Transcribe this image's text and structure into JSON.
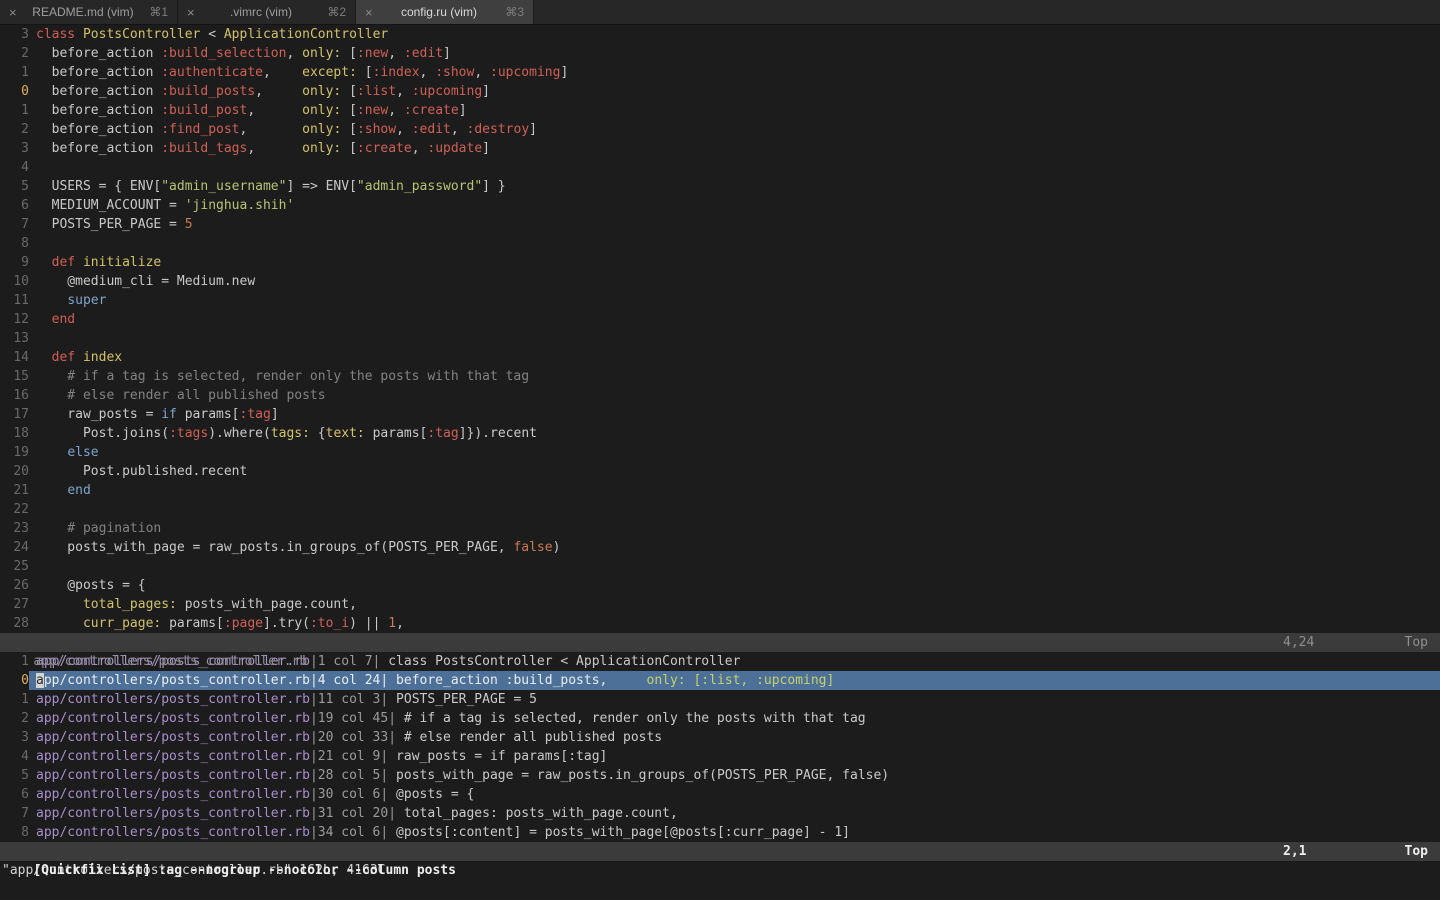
{
  "colors": {
    "bg": "#1c1c1c",
    "fg": "#c9c9c9",
    "red": "#cf6055",
    "yellow": "#d2c269",
    "green": "#b8c474",
    "blue": "#7ea5cc",
    "orange": "#cb7950",
    "comment": "#828282",
    "gutter": "#696969",
    "gutter_current": "#dfae5c",
    "qf_file": "#a78fcb",
    "qf_num": "#9b9b9b",
    "qf_sel_bg": "#4d7098",
    "qf_sel_fg": "#e9edf2",
    "qf_sel_match": "#c6d06b",
    "cursor_bg": "#d4d4d4",
    "cursor_fg": "#2a2a2a",
    "status_bg": "#3b3b3b",
    "tabbar_bg": "#272727",
    "tab_active_bg": "#3f3f3f"
  },
  "tabbar": {
    "close_glyph": "×",
    "tabs": [
      {
        "label": "README.md (vim)",
        "shortcut": "⌘1",
        "active": false
      },
      {
        "label": ".vimrc (vim)",
        "shortcut": "⌘2",
        "active": false
      },
      {
        "label": "config.ru (vim)",
        "shortcut": "⌘3",
        "active": true
      }
    ]
  },
  "editor": {
    "lines": [
      {
        "num": "3",
        "segs": [
          [
            "class ",
            "k"
          ],
          [
            "PostsController",
            "y"
          ],
          [
            " < ",
            "fg"
          ],
          [
            "ApplicationController",
            "y"
          ]
        ]
      },
      {
        "num": "2",
        "segs": [
          [
            "  before_action ",
            "fg"
          ],
          [
            ":build_selection",
            "k"
          ],
          [
            ", ",
            "fg"
          ],
          [
            "only:",
            "y"
          ],
          [
            " [",
            "fg"
          ],
          [
            ":new",
            "k"
          ],
          [
            ", ",
            "fg"
          ],
          [
            ":edit",
            "k"
          ],
          [
            "]",
            "fg"
          ]
        ]
      },
      {
        "num": "1",
        "segs": [
          [
            "  before_action ",
            "fg"
          ],
          [
            ":authenticate",
            "k"
          ],
          [
            ",    ",
            "fg"
          ],
          [
            "except:",
            "y"
          ],
          [
            " [",
            "fg"
          ],
          [
            ":index",
            "k"
          ],
          [
            ", ",
            "fg"
          ],
          [
            ":show",
            "k"
          ],
          [
            ", ",
            "fg"
          ],
          [
            ":upcoming",
            "k"
          ],
          [
            "]",
            "fg"
          ]
        ]
      },
      {
        "num": "0",
        "current": true,
        "segs": [
          [
            "  before_action ",
            "fg"
          ],
          [
            ":build_posts",
            "k"
          ],
          [
            ",     ",
            "fg"
          ],
          [
            "only:",
            "y"
          ],
          [
            " [",
            "fg"
          ],
          [
            ":list",
            "k"
          ],
          [
            ", ",
            "fg"
          ],
          [
            ":upcoming",
            "k"
          ],
          [
            "]",
            "fg"
          ]
        ]
      },
      {
        "num": "1",
        "segs": [
          [
            "  before_action ",
            "fg"
          ],
          [
            ":build_post",
            "k"
          ],
          [
            ",      ",
            "fg"
          ],
          [
            "only:",
            "y"
          ],
          [
            " [",
            "fg"
          ],
          [
            ":new",
            "k"
          ],
          [
            ", ",
            "fg"
          ],
          [
            ":create",
            "k"
          ],
          [
            "]",
            "fg"
          ]
        ]
      },
      {
        "num": "2",
        "segs": [
          [
            "  before_action ",
            "fg"
          ],
          [
            ":find_post",
            "k"
          ],
          [
            ",       ",
            "fg"
          ],
          [
            "only:",
            "y"
          ],
          [
            " [",
            "fg"
          ],
          [
            ":show",
            "k"
          ],
          [
            ", ",
            "fg"
          ],
          [
            ":edit",
            "k"
          ],
          [
            ", ",
            "fg"
          ],
          [
            ":destroy",
            "k"
          ],
          [
            "]",
            "fg"
          ]
        ]
      },
      {
        "num": "3",
        "segs": [
          [
            "  before_action ",
            "fg"
          ],
          [
            ":build_tags",
            "k"
          ],
          [
            ",      ",
            "fg"
          ],
          [
            "only:",
            "y"
          ],
          [
            " [",
            "fg"
          ],
          [
            ":create",
            "k"
          ],
          [
            ", ",
            "fg"
          ],
          [
            ":update",
            "k"
          ],
          [
            "]",
            "fg"
          ]
        ]
      },
      {
        "num": "4",
        "segs": []
      },
      {
        "num": "5",
        "segs": [
          [
            "  USERS = { ENV[",
            "fg"
          ],
          [
            "\"admin_username\"",
            "g"
          ],
          [
            "] => ENV[",
            "fg"
          ],
          [
            "\"admin_password\"",
            "g"
          ],
          [
            "] }",
            "fg"
          ]
        ]
      },
      {
        "num": "6",
        "segs": [
          [
            "  MEDIUM_ACCOUNT = ",
            "fg"
          ],
          [
            "'jinghua.shih'",
            "g"
          ]
        ]
      },
      {
        "num": "7",
        "segs": [
          [
            "  POSTS_PER_PAGE = ",
            "fg"
          ],
          [
            "5",
            "n"
          ]
        ]
      },
      {
        "num": "8",
        "segs": []
      },
      {
        "num": "9",
        "segs": [
          [
            "  ",
            "fg"
          ],
          [
            "def ",
            "k"
          ],
          [
            "initialize",
            "y"
          ]
        ]
      },
      {
        "num": "10",
        "segs": [
          [
            "    @medium_cli = Medium.new",
            "fg"
          ]
        ]
      },
      {
        "num": "11",
        "segs": [
          [
            "    ",
            "fg"
          ],
          [
            "super",
            "b"
          ]
        ]
      },
      {
        "num": "12",
        "segs": [
          [
            "  ",
            "fg"
          ],
          [
            "end",
            "k"
          ]
        ]
      },
      {
        "num": "13",
        "segs": []
      },
      {
        "num": "14",
        "segs": [
          [
            "  ",
            "fg"
          ],
          [
            "def ",
            "k"
          ],
          [
            "index",
            "y"
          ]
        ]
      },
      {
        "num": "15",
        "segs": [
          [
            "    # if a tag is selected, render only the posts with that tag",
            "c"
          ]
        ]
      },
      {
        "num": "16",
        "segs": [
          [
            "    # else render all published posts",
            "c"
          ]
        ]
      },
      {
        "num": "17",
        "segs": [
          [
            "    raw_posts = ",
            "fg"
          ],
          [
            "if",
            "b"
          ],
          [
            " params[",
            "fg"
          ],
          [
            ":tag",
            "k"
          ],
          [
            "]",
            "fg"
          ]
        ]
      },
      {
        "num": "18",
        "segs": [
          [
            "      Post.joins(",
            "fg"
          ],
          [
            ":tags",
            "k"
          ],
          [
            ").where(",
            "fg"
          ],
          [
            "tags:",
            "y"
          ],
          [
            " {",
            "fg"
          ],
          [
            "text:",
            "y"
          ],
          [
            " params[",
            "fg"
          ],
          [
            ":tag",
            "k"
          ],
          [
            "]}).recent",
            "fg"
          ]
        ]
      },
      {
        "num": "19",
        "segs": [
          [
            "    ",
            "fg"
          ],
          [
            "else",
            "b"
          ]
        ]
      },
      {
        "num": "20",
        "segs": [
          [
            "      Post.published.recent",
            "fg"
          ]
        ]
      },
      {
        "num": "21",
        "segs": [
          [
            "    ",
            "fg"
          ],
          [
            "end",
            "b"
          ]
        ]
      },
      {
        "num": "22",
        "segs": []
      },
      {
        "num": "23",
        "segs": [
          [
            "    # pagination",
            "c"
          ]
        ]
      },
      {
        "num": "24",
        "segs": [
          [
            "    posts_with_page = raw_posts.in_groups_of(POSTS_PER_PAGE, ",
            "fg"
          ],
          [
            "false",
            "n"
          ],
          [
            ")",
            "fg"
          ]
        ]
      },
      {
        "num": "25",
        "segs": []
      },
      {
        "num": "26",
        "segs": [
          [
            "    @posts = {",
            "fg"
          ]
        ]
      },
      {
        "num": "27",
        "segs": [
          [
            "      ",
            "fg"
          ],
          [
            "total_pages:",
            "y"
          ],
          [
            " posts_with_page.count,",
            "fg"
          ]
        ]
      },
      {
        "num": "28",
        "segs": [
          [
            "      ",
            "fg"
          ],
          [
            "curr_page:",
            "y"
          ],
          [
            " params[",
            "fg"
          ],
          [
            ":page",
            "k"
          ],
          [
            "].try(",
            "fg"
          ],
          [
            ":to_i",
            "k"
          ],
          [
            ") || ",
            "fg"
          ],
          [
            "1",
            "n"
          ],
          [
            ",",
            "fg"
          ]
        ]
      }
    ]
  },
  "status_editor": {
    "left": "app/controllers/posts_controller.rb",
    "position": "4,24",
    "scroll": "Top"
  },
  "quickfix": {
    "lines": [
      {
        "num": "1",
        "segs": [
          [
            "app/controllers/posts_controller.rb",
            "qf"
          ],
          [
            "|1 col 7|",
            "qn"
          ],
          [
            " class PostsController < ApplicationController",
            "fg"
          ]
        ]
      },
      {
        "num": "0",
        "current": true,
        "selected": true,
        "segs": [
          [
            "a",
            "cursor"
          ],
          [
            "pp/controllers/posts_controller.rb",
            "qsel"
          ],
          [
            "|4 col 24|",
            "qsel"
          ],
          [
            " before_action :build_posts,     ",
            "qsel"
          ],
          [
            "only: [:list, :upcoming]",
            "qsely"
          ]
        ]
      },
      {
        "num": "1",
        "segs": [
          [
            "app/controllers/posts_controller.rb",
            "qf"
          ],
          [
            "|11 col 3|",
            "qn"
          ],
          [
            " POSTS_PER_PAGE = 5",
            "fg"
          ]
        ]
      },
      {
        "num": "2",
        "segs": [
          [
            "app/controllers/posts_controller.rb",
            "qf"
          ],
          [
            "|19 col 45|",
            "qn"
          ],
          [
            " # if a tag is selected, render only the posts with that tag",
            "fg"
          ]
        ]
      },
      {
        "num": "3",
        "segs": [
          [
            "app/controllers/posts_controller.rb",
            "qf"
          ],
          [
            "|20 col 33|",
            "qn"
          ],
          [
            " # else render all published posts",
            "fg"
          ]
        ]
      },
      {
        "num": "4",
        "segs": [
          [
            "app/controllers/posts_controller.rb",
            "qf"
          ],
          [
            "|21 col 9|",
            "qn"
          ],
          [
            " raw_posts = if params[:tag]",
            "fg"
          ]
        ]
      },
      {
        "num": "5",
        "segs": [
          [
            "app/controllers/posts_controller.rb",
            "qf"
          ],
          [
            "|28 col 5|",
            "qn"
          ],
          [
            " posts_with_page = raw_posts.in_groups_of(POSTS_PER_PAGE, false)",
            "fg"
          ]
        ]
      },
      {
        "num": "6",
        "segs": [
          [
            "app/controllers/posts_controller.rb",
            "qf"
          ],
          [
            "|30 col 6|",
            "qn"
          ],
          [
            " @posts = {",
            "fg"
          ]
        ]
      },
      {
        "num": "7",
        "segs": [
          [
            "app/controllers/posts_controller.rb",
            "qf"
          ],
          [
            "|31 col 20|",
            "qn"
          ],
          [
            " total_pages: posts_with_page.count,",
            "fg"
          ]
        ]
      },
      {
        "num": "8",
        "segs": [
          [
            "app/controllers/posts_controller.rb",
            "qf"
          ],
          [
            "|34 col 6|",
            "qn"
          ],
          [
            " @posts[:content] = posts_with_page[@posts[:curr_page] - 1]",
            "fg"
          ]
        ]
      }
    ]
  },
  "status_quickfix": {
    "left": "[Quickfix List] :ag --nogroup --nocolor --column posts",
    "position": "2,1",
    "scroll": "Top"
  },
  "cmdline": {
    "text": "\"app/controllers/posts_controller.rb\" 162L, 4163C"
  }
}
